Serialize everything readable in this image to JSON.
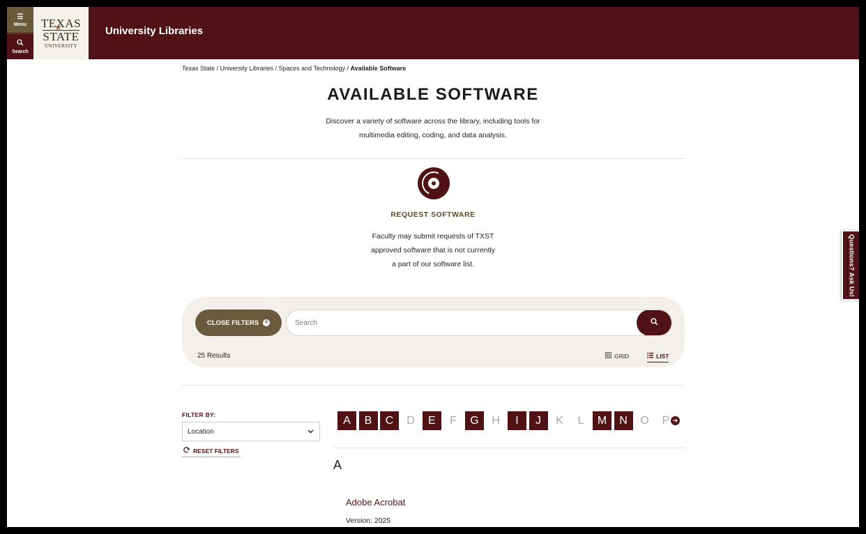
{
  "header": {
    "menu_label": "Menu",
    "search_label": "Search",
    "logo": {
      "line1": "TEXAS",
      "line2": "STATE",
      "line3": "UNIVERSITY"
    },
    "site_title": "University Libraries",
    "brand_color": "#501214"
  },
  "breadcrumb": {
    "items": [
      "Texas State",
      "University Libraries",
      "Spaces and Technology"
    ],
    "separator": " / ",
    "current": "Available Software"
  },
  "page": {
    "title": "AVAILABLE SOFTWARE",
    "intro_line1": "Discover a variety of software across the library, including tools for",
    "intro_line2": "multimedia editing, coding, and data analysis."
  },
  "request": {
    "icon": "disc-icon",
    "title": "REQUEST SOFTWARE",
    "line1": "Faculty may submit requests of TXST",
    "line2": "approved software that is not currently",
    "line3": "a part of our software list."
  },
  "filters": {
    "close_label": "CLOSE FILTERS",
    "search_placeholder": "Search",
    "results": "25 Results",
    "grid_label": "GRID",
    "list_label": "LIST",
    "filter_by": "FILTER BY:",
    "location_value": "Location",
    "reset_label": "RESET FILTERS"
  },
  "alphabet": {
    "letters": [
      "A",
      "B",
      "C",
      "D",
      "E",
      "F",
      "G",
      "H",
      "I",
      "J",
      "K",
      "L",
      "M",
      "N",
      "O",
      "P"
    ],
    "active": [
      "A",
      "B",
      "C",
      "E",
      "G",
      "I",
      "J",
      "M",
      "N"
    ]
  },
  "listing": {
    "section": "A",
    "item_title": "Adobe Acrobat",
    "item_version": "Version: 2025"
  },
  "ask_tab": "Questions? Ask Us!"
}
